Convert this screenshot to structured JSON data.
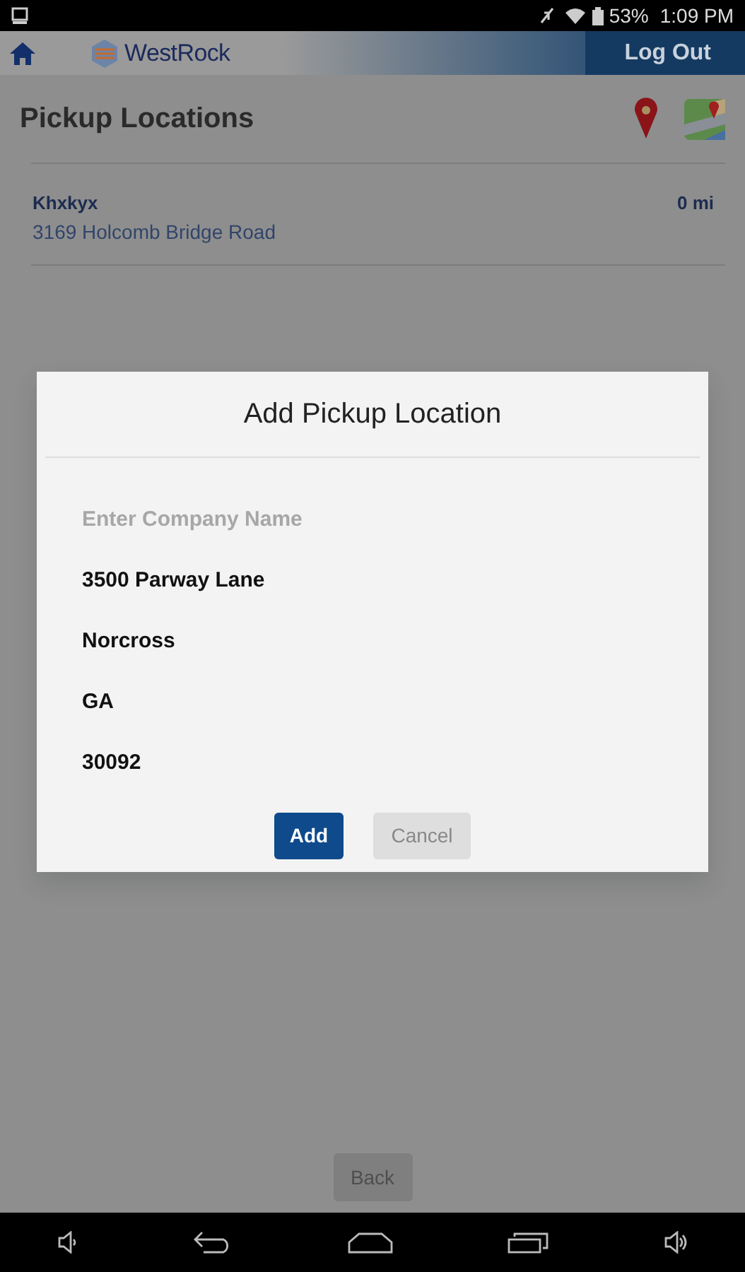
{
  "status_bar": {
    "battery": "53%",
    "time": "1:09 PM"
  },
  "header": {
    "brand": "WestRock",
    "logout": "Log Out"
  },
  "title": "Pickup Locations",
  "locations": [
    {
      "name": "Khxkyx",
      "address": "3169 Holcomb Bridge Road",
      "distance": "0 mi"
    }
  ],
  "dialog": {
    "title": "Add Pickup Location",
    "fields": [
      {
        "placeholder": "Enter Company Name"
      },
      {
        "value": "3500 Parway Lane"
      },
      {
        "value": "Norcross"
      },
      {
        "value": "GA"
      },
      {
        "value": "30092"
      }
    ],
    "buttons": [
      {
        "label": "Add",
        "kind": "primary"
      },
      {
        "label": "Cancel",
        "kind": "secondary"
      }
    ]
  },
  "back_button": "Back"
}
